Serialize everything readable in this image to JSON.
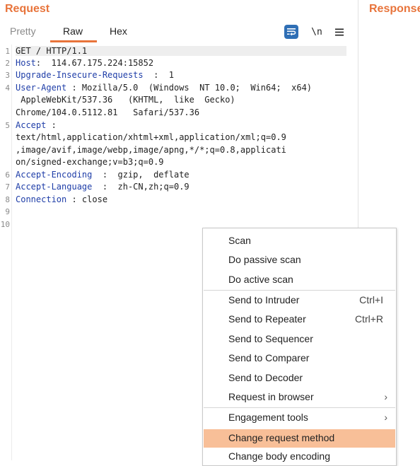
{
  "request": {
    "title": "Request",
    "tabs": [
      {
        "label": "Pretty"
      },
      {
        "label": "Raw"
      },
      {
        "label": "Hex"
      }
    ],
    "tools": {
      "wrap_icon": "wrap-lines-icon",
      "newline_label": "\\n",
      "menu_icon": "hamburger-menu-icon"
    },
    "editor": {
      "line_numbers": [
        "1",
        "2",
        "3",
        "4",
        "5",
        "6",
        "7",
        "8",
        "9",
        "10"
      ],
      "lines": [
        {
          "key": "",
          "value": "GET / HTTP/1.1"
        },
        {
          "key": "Host",
          "value": ":  114.67.175.224:15852"
        },
        {
          "key": "Upgrade-Insecure-Requests",
          "value": "  :  1"
        },
        {
          "key": "User-Agent",
          "value": " : Mozilla/5.0  (Windows  NT 10.0;  Win64;  x64)"
        },
        {
          "key": "",
          "value": " AppleWebKit/537.36   (KHTML,  like  Gecko)"
        },
        {
          "key": "",
          "value": "Chrome/104.0.5112.81   Safari/537.36"
        },
        {
          "key": "Accept",
          "value": " :"
        },
        {
          "key": "",
          "value": "text/html,application/xhtml+xml,application/xml;q=0.9"
        },
        {
          "key": "",
          "value": ",image/avif,image/webp,image/apng,*/*;q=0.8,applicati"
        },
        {
          "key": "",
          "value": "on/signed-exchange;v=b3;q=0.9"
        },
        {
          "key": "Accept-Encoding",
          "value": "  :  gzip,  deflate"
        },
        {
          "key": "Accept-Language",
          "value": "  :  zh-CN,zh;q=0.9"
        },
        {
          "key": "Connection",
          "value": " : close"
        }
      ]
    }
  },
  "response": {
    "title": "Response"
  },
  "context_menu": {
    "items": [
      {
        "label": "Scan"
      },
      {
        "label": "Do passive scan"
      },
      {
        "label": "Do active scan"
      },
      {
        "label": "Send to Intruder",
        "shortcut": "Ctrl+I"
      },
      {
        "label": "Send to Repeater",
        "shortcut": "Ctrl+R"
      },
      {
        "label": "Send to Sequencer"
      },
      {
        "label": "Send to Comparer"
      },
      {
        "label": "Send to Decoder"
      },
      {
        "label": "Request in browser",
        "submenu_icon": "chevron-right-icon"
      },
      {
        "label": "Engagement tools",
        "submenu_icon": "chevron-right-icon"
      },
      {
        "label": "Change request method"
      },
      {
        "label": "Change body encoding"
      }
    ],
    "highlight_color": "#f8bf98"
  },
  "colors": {
    "accent": "#e8743b",
    "header_key": "#1f3ea8"
  }
}
